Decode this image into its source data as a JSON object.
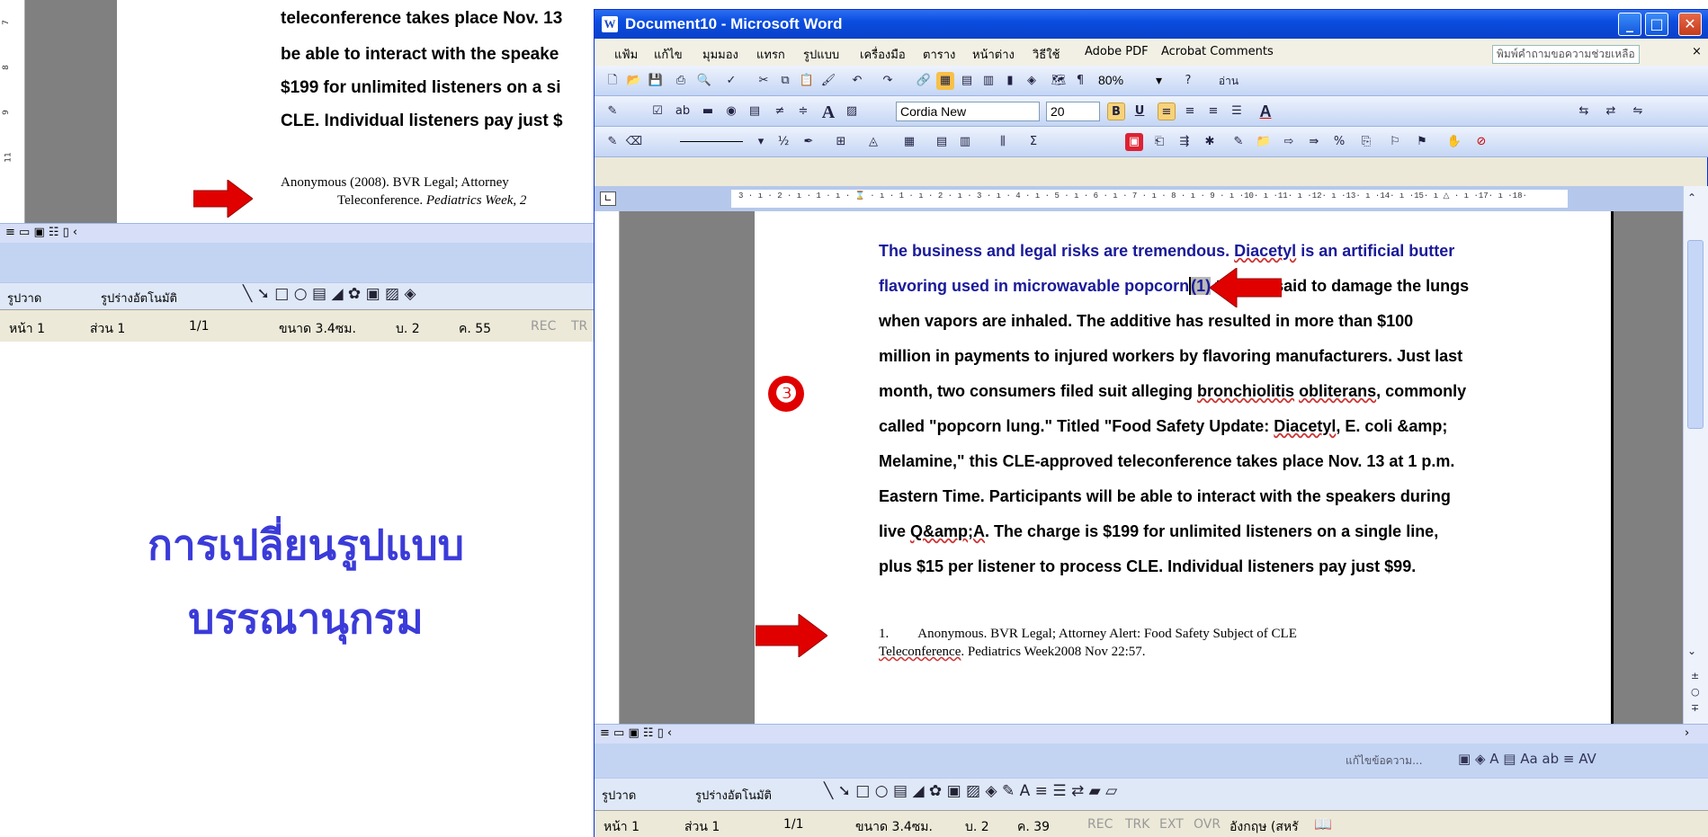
{
  "background_window": {
    "lines": [
      "teleconference takes place Nov. 13",
      "be able to interact with the speake",
      "$199 for unlimited listeners on a si",
      "CLE. Individual listeners pay just $"
    ],
    "reference_line1": "Anonymous (2008). BVR Legal; Attorney",
    "reference_line2_plain": "Teleconference. ",
    "reference_line2_italic": "Pediatrics Week, 2",
    "draw_label": "รูปวาด",
    "autoshape_label": "รูปร่างอัตโนมัติ",
    "status": {
      "page": "หน้า 1",
      "section": "ส่วน 1",
      "pages": "1/1",
      "position": "ขนาด 3.4ซม.",
      "line": "บ. 2",
      "col": "ค. 55",
      "rec": "REC",
      "trk": "TR"
    }
  },
  "main_window": {
    "title": "Document10 - Microsoft Word",
    "menu": [
      "แฟ้ม",
      "แก้ไข",
      "มุมมอง",
      "แทรก",
      "รูปแบบ",
      "เครื่องมือ",
      "ตาราง",
      "หน้าต่าง",
      "วิธีใช้",
      "Adobe PDF",
      "Acrobat Comments"
    ],
    "help_box": "พิมพ์คำถามขอความช่วยเหลือ",
    "zoom": "80%",
    "read_label": "อ่าน",
    "font_name": "Cordia New",
    "font_size": "20",
    "weight_label": "½",
    "ruler_text": "3 · ı · 2 · ı · 1 · ı · ⌛ · ı · 1 · ı · 2 · ı · 3 · ı · 4 · ı · 5 · ı · 6 · ı · 7 · ı · 8 · ı · 9 · ı ·10· ı ·11· ı ·12· ı ·13· ı ·14· ı ·15· ı △ · ı ·17· ı ·18·",
    "document": {
      "line1_a": "The business and legal risks are tremendous. ",
      "line1_b": "Diacetyl",
      "line1_c": " is an artificial butter",
      "line2_a": "flavoring used in microwavable popcorn",
      "line2_ref": "(1)",
      "line2_b": " t",
      "line2_c": "said to damage the lungs",
      "line3": "when vapors are inhaled. The additive has resulted in more than $100",
      "line4": "million in payments to injured workers by flavoring manufacturers. Just last",
      "line5_a": "month, two consumers filed suit alleging ",
      "line5_b": "bronchiolitis",
      "line5_c": " ",
      "line5_d": "obliterans",
      "line5_e": ", commonly",
      "line6_a": "called \"popcorn lung.\" Titled \"Food Safety Update: ",
      "line6_b": "Diacetyl",
      "line6_c": ", E. coli &amp;",
      "line7": "Melamine,\" this CLE-approved teleconference takes place Nov. 13 at 1 p.m.",
      "line8": "Eastern Time. Participants will be able to interact with the speakers during",
      "line9_a": "live ",
      "line9_b": "Q&amp;A",
      "line9_c": ". The charge is $199 for unlimited listeners on a single line,",
      "line10": "plus $15 per listener to process CLE. Individual listeners pay just $99.",
      "ref_num": "1.",
      "ref_text": "Anonymous. BVR Legal; Attorney Alert: Food Safety Subject of CLE",
      "ref_line2_a": "Teleconference",
      "ref_line2_b": ". Pediatrics Week2008 Nov 22:57."
    },
    "review_label": "แก้ไขข้อความ...",
    "draw_label": "รูปวาด",
    "autoshape_label": "รูปร่างอัตโนมัติ",
    "status": {
      "page": "หน้า 1",
      "section": "ส่วน 1",
      "pages": "1/1",
      "position": "ขนาด 3.4ซม.",
      "line": "บ. 2",
      "col": "ค. 39",
      "rec": "REC",
      "trk": "TRK",
      "ext": "EXT",
      "ovr": "OVR",
      "lang": "อังกฤษ (สหรั"
    }
  },
  "slide": {
    "title_line1": "การเปลี่ยนรูปแบบ",
    "title_line2": "บรรณานุกรม",
    "step_number": "❸"
  },
  "colors": {
    "title_blue": "#3b3bd9",
    "arrow_red": "#e00000",
    "xp_blue": "#0a4de0"
  }
}
